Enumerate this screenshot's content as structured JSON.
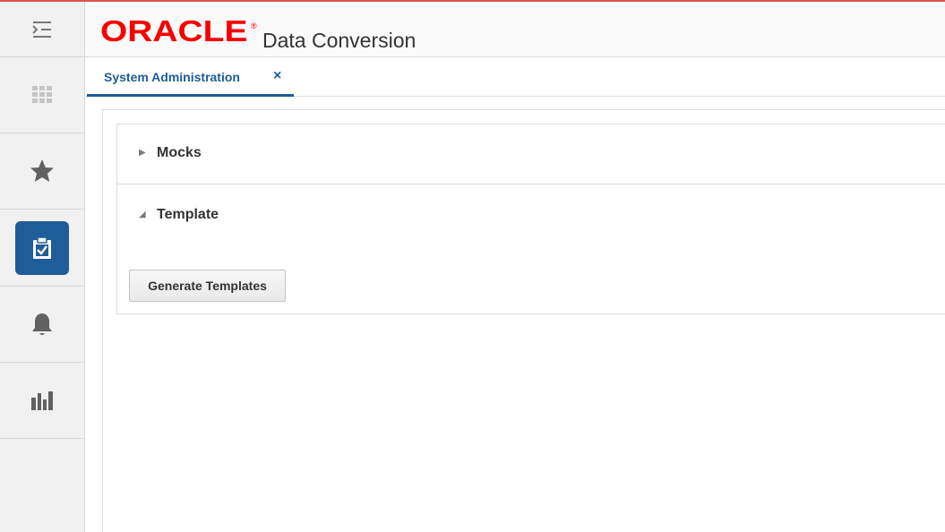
{
  "header": {
    "logo_text": "ORACLE",
    "logo_trademark": "®",
    "app_title": "Data Conversion"
  },
  "sidebar": {
    "items": [
      {
        "icon": "menu-toggle-icon"
      },
      {
        "icon": "grid-icon"
      },
      {
        "icon": "star-icon"
      },
      {
        "icon": "clipboard-check-icon",
        "active": true
      },
      {
        "icon": "bell-icon"
      },
      {
        "icon": "bar-chart-icon"
      }
    ]
  },
  "tabs": [
    {
      "label": "System Administration",
      "close_label": "×"
    }
  ],
  "panels": {
    "mocks": {
      "title": "Mocks",
      "expanded": false,
      "disclosure": "▶"
    },
    "template": {
      "title": "Template",
      "expanded": true,
      "disclosure": "◢",
      "button_label": "Generate Templates"
    }
  },
  "colors": {
    "brand_red": "#f80000",
    "accent_blue": "#1f5c99",
    "sidebar_bg": "#f1f1f1"
  }
}
